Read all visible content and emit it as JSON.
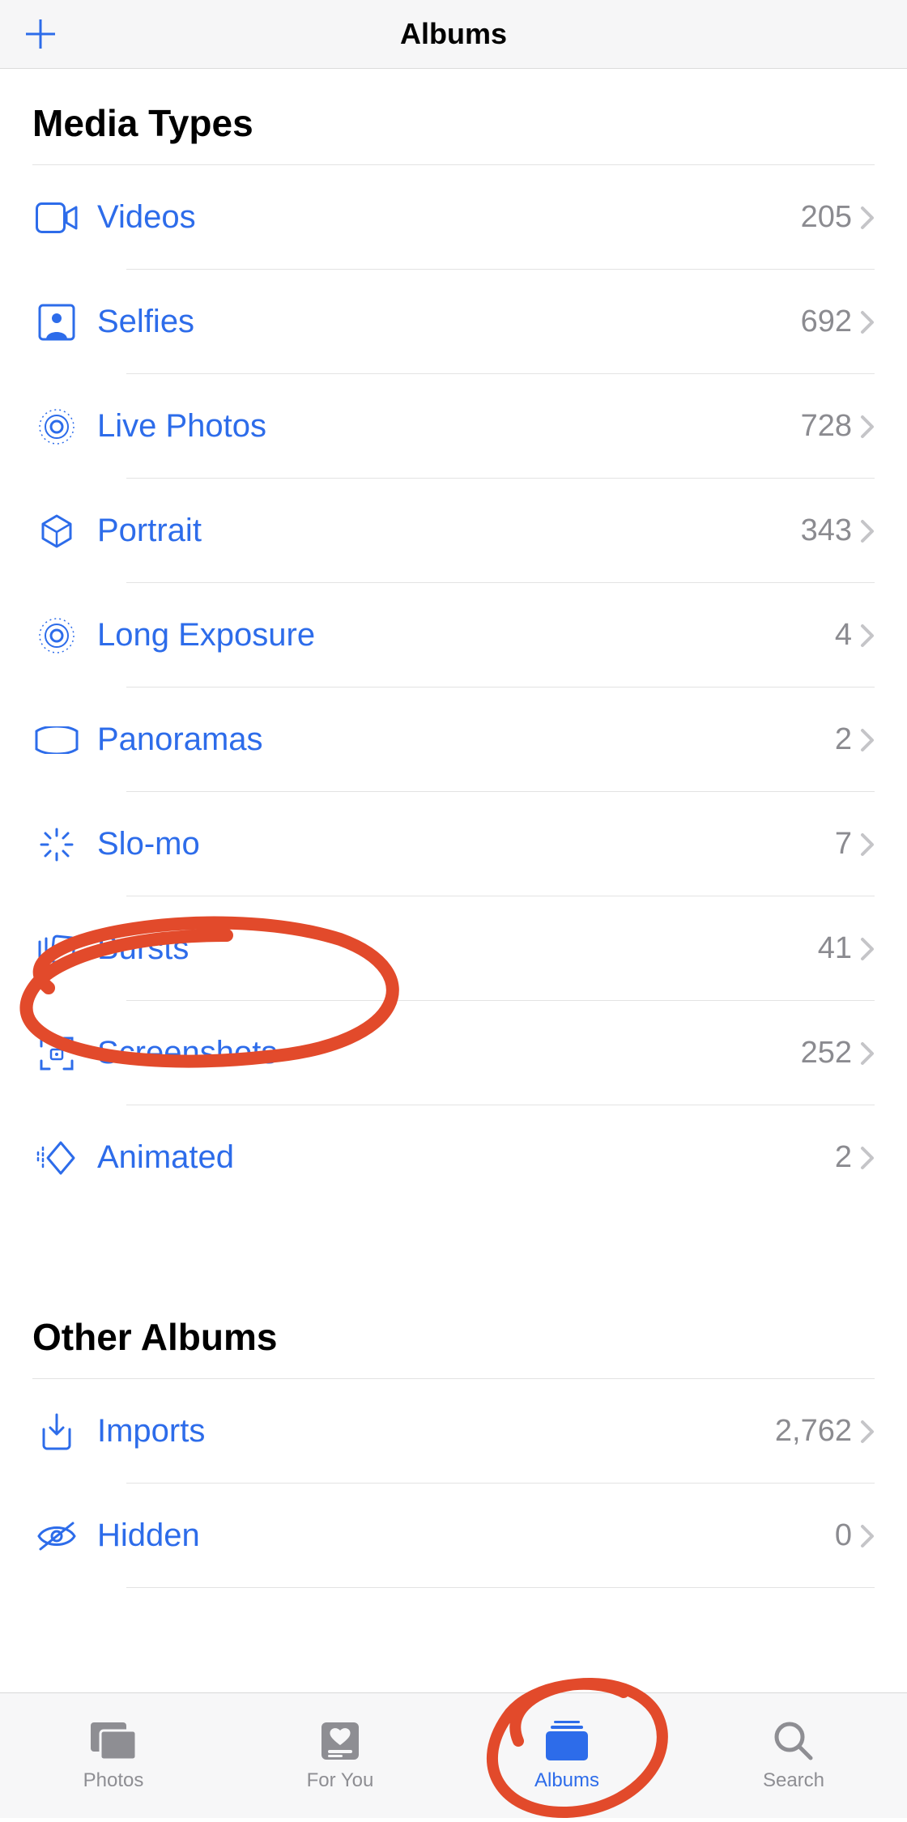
{
  "nav": {
    "title": "Albums"
  },
  "sections": {
    "media_types": {
      "header": "Media Types",
      "items": [
        {
          "label": "Videos",
          "count": "205"
        },
        {
          "label": "Selfies",
          "count": "692"
        },
        {
          "label": "Live Photos",
          "count": "728"
        },
        {
          "label": "Portrait",
          "count": "343"
        },
        {
          "label": "Long Exposure",
          "count": "4"
        },
        {
          "label": "Panoramas",
          "count": "2"
        },
        {
          "label": "Slo-mo",
          "count": "7"
        },
        {
          "label": "Bursts",
          "count": "41"
        },
        {
          "label": "Screenshots",
          "count": "252"
        },
        {
          "label": "Animated",
          "count": "2"
        }
      ]
    },
    "other_albums": {
      "header": "Other Albums",
      "items": [
        {
          "label": "Imports",
          "count": "2,762"
        },
        {
          "label": "Hidden",
          "count": "0"
        }
      ]
    }
  },
  "tabs": [
    {
      "label": "Photos",
      "active": false
    },
    {
      "label": "For You",
      "active": false
    },
    {
      "label": "Albums",
      "active": true
    },
    {
      "label": "Search",
      "active": false
    }
  ],
  "annotations": {
    "circled_row": "Bursts",
    "circled_tab": "Albums",
    "color": "#e24a2b"
  }
}
